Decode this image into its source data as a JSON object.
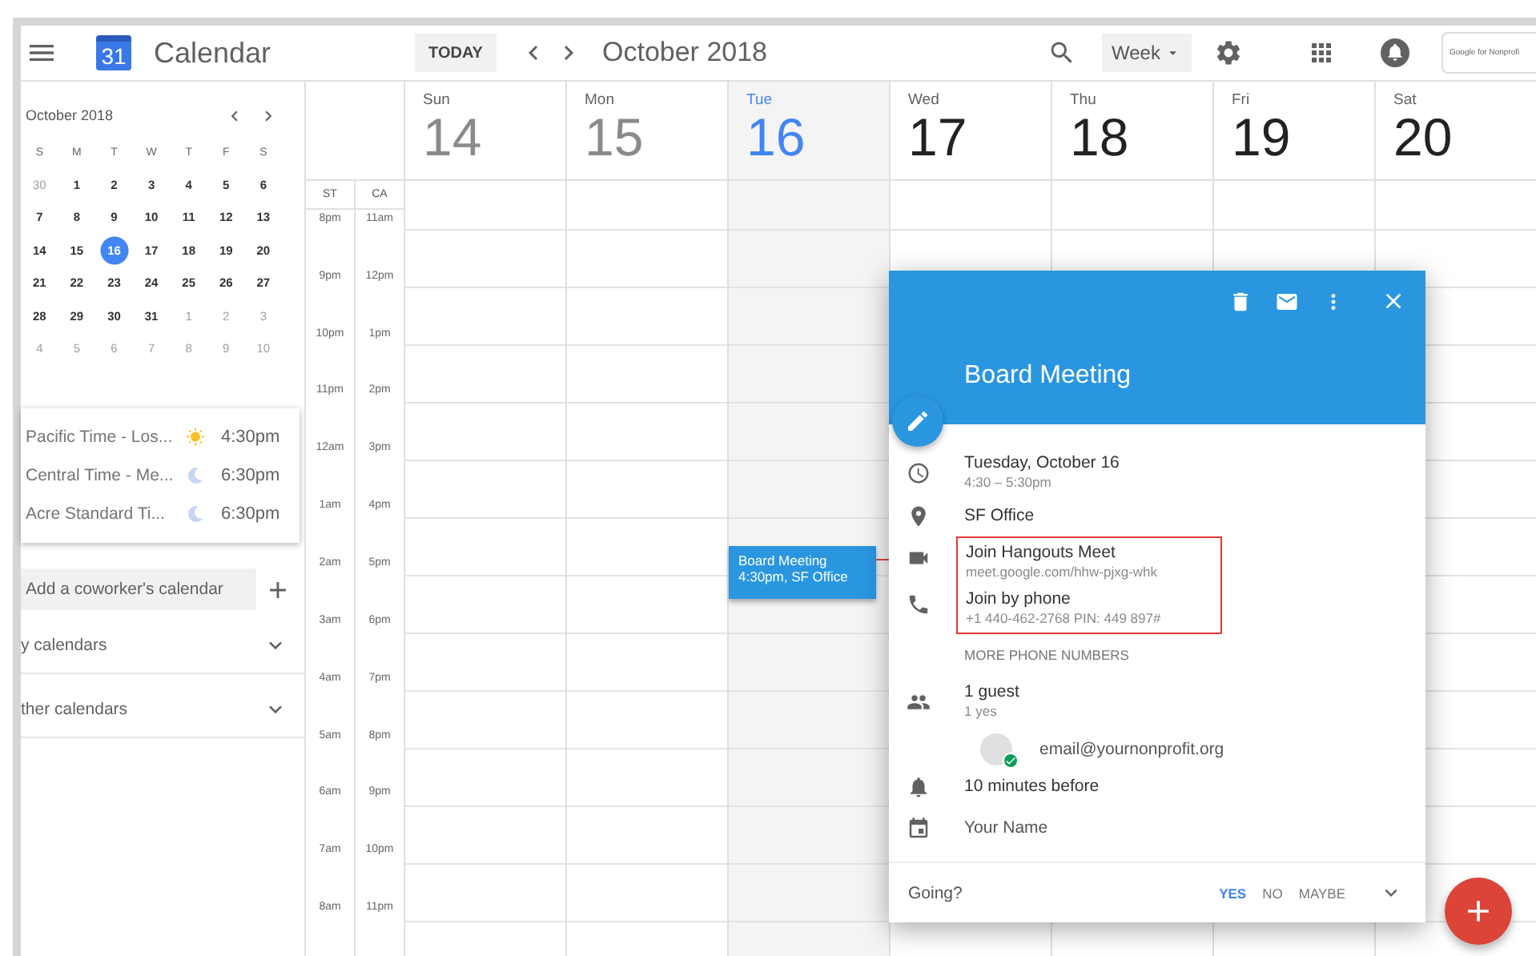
{
  "header": {
    "logo_text": "31",
    "app_title": "Calendar",
    "today_button": "TODAY",
    "period": "October 2018",
    "view_select": "Week",
    "brand_badge": "Google for Nonprofi"
  },
  "mini_calendar": {
    "title": "October 2018",
    "weekdays": [
      "S",
      "M",
      "T",
      "W",
      "T",
      "F",
      "S"
    ],
    "weeks": [
      [
        {
          "day": "30",
          "muted": true,
          "selected": false
        },
        {
          "day": "1",
          "muted": false,
          "selected": false
        },
        {
          "day": "2",
          "muted": false,
          "selected": false
        },
        {
          "day": "3",
          "muted": false,
          "selected": false
        },
        {
          "day": "4",
          "muted": false,
          "selected": false
        },
        {
          "day": "5",
          "muted": false,
          "selected": false
        },
        {
          "day": "6",
          "muted": false,
          "selected": false
        }
      ],
      [
        {
          "day": "7",
          "muted": false,
          "selected": false
        },
        {
          "day": "8",
          "muted": false,
          "selected": false
        },
        {
          "day": "9",
          "muted": false,
          "selected": false
        },
        {
          "day": "10",
          "muted": false,
          "selected": false
        },
        {
          "day": "11",
          "muted": false,
          "selected": false
        },
        {
          "day": "12",
          "muted": false,
          "selected": false
        },
        {
          "day": "13",
          "muted": false,
          "selected": false
        }
      ],
      [
        {
          "day": "14",
          "muted": false,
          "selected": false
        },
        {
          "day": "15",
          "muted": false,
          "selected": false
        },
        {
          "day": "16",
          "muted": false,
          "selected": true
        },
        {
          "day": "17",
          "muted": false,
          "selected": false
        },
        {
          "day": "18",
          "muted": false,
          "selected": false
        },
        {
          "day": "19",
          "muted": false,
          "selected": false
        },
        {
          "day": "20",
          "muted": false,
          "selected": false
        }
      ],
      [
        {
          "day": "21",
          "muted": false,
          "selected": false
        },
        {
          "day": "22",
          "muted": false,
          "selected": false
        },
        {
          "day": "23",
          "muted": false,
          "selected": false
        },
        {
          "day": "24",
          "muted": false,
          "selected": false
        },
        {
          "day": "25",
          "muted": false,
          "selected": false
        },
        {
          "day": "26",
          "muted": false,
          "selected": false
        },
        {
          "day": "27",
          "muted": false,
          "selected": false
        }
      ],
      [
        {
          "day": "28",
          "muted": false,
          "selected": false
        },
        {
          "day": "29",
          "muted": false,
          "selected": false
        },
        {
          "day": "30",
          "muted": false,
          "selected": false
        },
        {
          "day": "31",
          "muted": false,
          "selected": false
        },
        {
          "day": "1",
          "muted": true,
          "selected": false
        },
        {
          "day": "2",
          "muted": true,
          "selected": false
        },
        {
          "day": "3",
          "muted": true,
          "selected": false
        }
      ],
      [
        {
          "day": "4",
          "muted": true,
          "selected": false
        },
        {
          "day": "5",
          "muted": true,
          "selected": false
        },
        {
          "day": "6",
          "muted": true,
          "selected": false
        },
        {
          "day": "7",
          "muted": true,
          "selected": false
        },
        {
          "day": "8",
          "muted": true,
          "selected": false
        },
        {
          "day": "9",
          "muted": true,
          "selected": false
        },
        {
          "day": "10",
          "muted": true,
          "selected": false
        }
      ]
    ]
  },
  "world_clock": [
    {
      "zone": "Pacific Time - Los...",
      "kind": "day",
      "time": "4:30pm"
    },
    {
      "zone": "Central Time - Me...",
      "kind": "night",
      "time": "6:30pm"
    },
    {
      "zone": "Acre Standard Ti...",
      "kind": "night",
      "time": "6:30pm"
    }
  ],
  "coworker_field": {
    "placeholder": "Add a coworker's calendar"
  },
  "calendar_sections": [
    {
      "label": "y calendars",
      "expanded": false
    },
    {
      "label": "ther calendars",
      "expanded": false
    }
  ],
  "time_zones": [
    {
      "label": "ST",
      "hours": [
        "8pm",
        "9pm",
        "10pm",
        "11pm",
        "12am",
        "1am",
        "2am",
        "3am",
        "4am",
        "5am",
        "6am",
        "7am",
        "8am"
      ]
    },
    {
      "label": "CA",
      "hours": [
        "11am",
        "12pm",
        "1pm",
        "2pm",
        "3pm",
        "4pm",
        "5pm",
        "6pm",
        "7pm",
        "8pm",
        "9pm",
        "10pm",
        "11pm"
      ]
    }
  ],
  "days": [
    {
      "weekday": "Sun",
      "date": "14",
      "selected": false,
      "past": true
    },
    {
      "weekday": "Mon",
      "date": "15",
      "selected": false,
      "past": true
    },
    {
      "weekday": "Tue",
      "date": "16",
      "selected": true,
      "past": false,
      "event": {
        "title": "Board Meeting",
        "subtitle": "4:30pm, SF Office"
      }
    },
    {
      "weekday": "Wed",
      "date": "17",
      "selected": false,
      "past": false
    },
    {
      "weekday": "Thu",
      "date": "18",
      "selected": false,
      "past": false
    },
    {
      "weekday": "Fri",
      "date": "19",
      "selected": false,
      "past": false
    },
    {
      "weekday": "Sat",
      "date": "20",
      "selected": false,
      "past": false
    }
  ],
  "event_popup": {
    "title": "Board Meeting",
    "date": "Tuesday, October 16",
    "time": "4:30 – 5:30pm",
    "location": "SF Office",
    "meet_title": "Join Hangouts Meet",
    "meet_link": "meet.google.com/hhw-pjxg-whk",
    "phone_title": "Join by phone",
    "phone_number": "+1 440-462-2768 PIN: 449 897#",
    "more_phones": "MORE PHONE NUMBERS",
    "guests": "1 guest",
    "guest_summary": "1 yes",
    "guest_email": "email@yournonprofit.org",
    "reminder": "10 minutes before",
    "organizer": "Your Name",
    "rsvp_label": "Going?",
    "rsvp": [
      {
        "label": "YES",
        "selected": true
      },
      {
        "label": "NO",
        "selected": false
      },
      {
        "label": "MAYBE",
        "selected": false
      }
    ]
  }
}
